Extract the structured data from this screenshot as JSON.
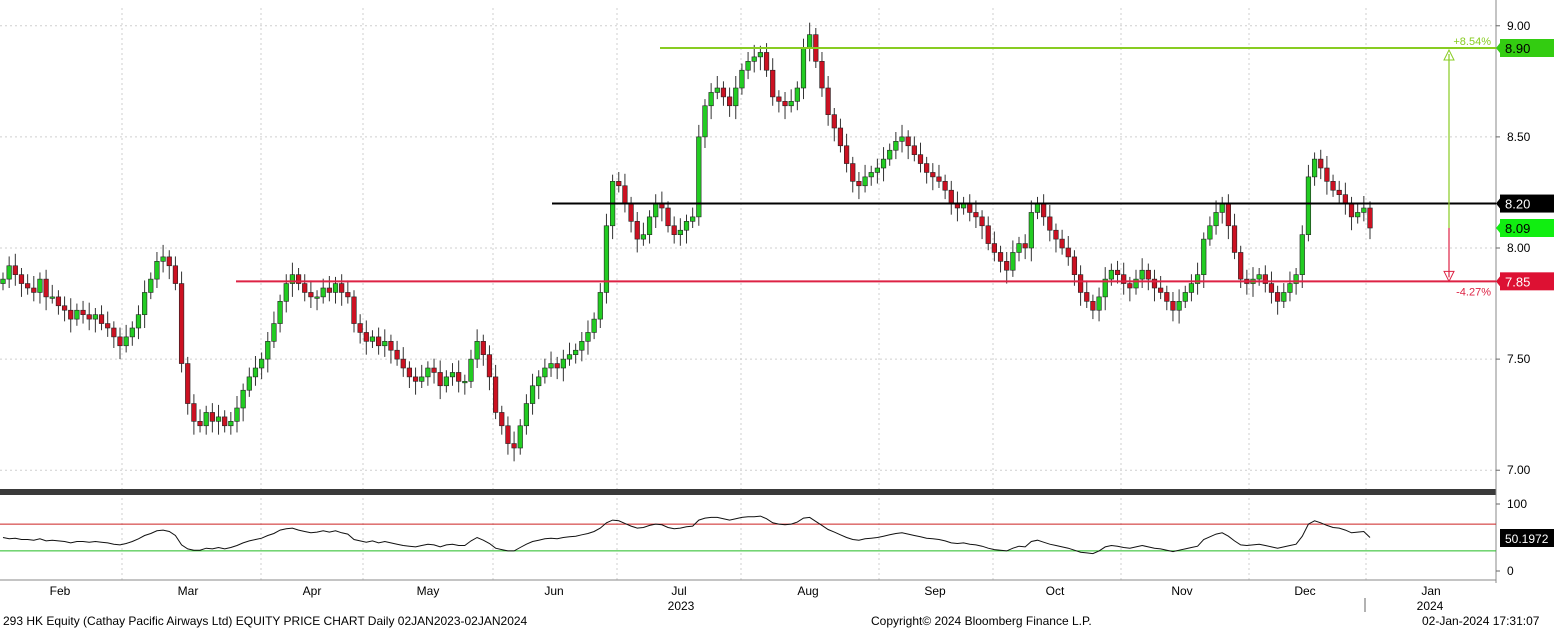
{
  "footer": {
    "description": "293 HK Equity (Cathay Pacific Airways Ltd) EQUITY PRICE CHART  Daily 02JAN2023-02JAN2024",
    "copyright": "Copyright© 2024 Bloomberg Finance L.P.",
    "timestamp": "02-Jan-2024 17:31:07"
  },
  "colors": {
    "up": "#22cc22",
    "down": "#cc1122",
    "resistance": "#88cc22",
    "support": "#dd2244",
    "pivot": "#000000",
    "rsi_over": "#cc2222",
    "rsi_under": "#22bb22"
  },
  "chart_data": [
    {
      "type": "candlestick",
      "ticker": "293 HK Equity",
      "x_month_labels": [
        "Feb",
        "Mar",
        "Apr",
        "May",
        "Jun",
        "Jul",
        "Aug",
        "Sep",
        "Oct",
        "Nov",
        "Dec",
        "Jan"
      ],
      "x_year_labels": [
        "2023",
        "2024"
      ],
      "y_ticks": [
        "9.00",
        "8.50",
        "8.00",
        "7.50",
        "7.00"
      ],
      "ylim": [
        6.92,
        9.08
      ],
      "price_labels": {
        "resistance": "8.90",
        "pivot": "8.20",
        "last": "8.09",
        "support": "7.85"
      },
      "pct_labels": {
        "up": "+8.54%",
        "down": "-4.27%"
      },
      "levels": {
        "resistance": 8.9,
        "pivot": 8.2,
        "support": 7.85
      },
      "series_close": [
        7.86,
        7.92,
        7.88,
        7.84,
        7.82,
        7.8,
        7.86,
        7.78,
        7.78,
        7.74,
        7.72,
        7.68,
        7.72,
        7.7,
        7.68,
        7.7,
        7.66,
        7.64,
        7.6,
        7.56,
        7.6,
        7.64,
        7.7,
        7.8,
        7.86,
        7.94,
        7.96,
        7.92,
        7.84,
        7.48,
        7.3,
        7.22,
        7.2,
        7.26,
        7.22,
        7.24,
        7.2,
        7.22,
        7.28,
        7.36,
        7.42,
        7.46,
        7.5,
        7.58,
        7.66,
        7.76,
        7.84,
        7.88,
        7.84,
        7.8,
        7.78,
        7.78,
        7.82,
        7.8,
        7.84,
        7.8,
        7.78,
        7.66,
        7.62,
        7.58,
        7.6,
        7.56,
        7.58,
        7.54,
        7.5,
        7.46,
        7.42,
        7.4,
        7.42,
        7.46,
        7.44,
        7.38,
        7.42,
        7.44,
        7.4,
        7.4,
        7.5,
        7.58,
        7.52,
        7.42,
        7.26,
        7.2,
        7.12,
        7.1,
        7.2,
        7.3,
        7.38,
        7.42,
        7.46,
        7.48,
        7.46,
        7.5,
        7.52,
        7.54,
        7.58,
        7.62,
        7.68,
        7.8,
        8.1,
        8.3,
        8.28,
        8.2,
        8.12,
        8.04,
        8.06,
        8.14,
        8.2,
        8.18,
        8.1,
        8.06,
        8.08,
        8.12,
        8.14,
        8.5,
        8.64,
        8.7,
        8.72,
        8.68,
        8.64,
        8.72,
        8.8,
        8.84,
        8.86,
        8.88,
        8.8,
        8.68,
        8.66,
        8.64,
        8.66,
        8.72,
        8.9,
        8.96,
        8.84,
        8.72,
        8.6,
        8.54,
        8.46,
        8.38,
        8.3,
        8.28,
        8.32,
        8.34,
        8.36,
        8.4,
        8.44,
        8.48,
        8.5,
        8.46,
        8.42,
        8.38,
        8.34,
        8.32,
        8.3,
        8.26,
        8.2,
        8.18,
        8.2,
        8.16,
        8.14,
        8.1,
        8.02,
        7.98,
        7.94,
        7.9,
        7.98,
        8.02,
        8.0,
        8.16,
        8.2,
        8.14,
        8.08,
        8.04,
        8.0,
        7.96,
        7.88,
        7.8,
        7.76,
        7.72,
        7.78,
        7.86,
        7.9,
        7.88,
        7.84,
        7.82,
        7.86,
        7.9,
        7.86,
        7.82,
        7.8,
        7.76,
        7.72,
        7.76,
        7.8,
        7.84,
        7.88,
        8.04,
        8.1,
        8.16,
        8.2,
        8.1,
        7.98,
        7.86,
        7.84,
        7.86,
        7.88,
        7.84,
        7.8,
        7.76,
        7.8,
        7.84,
        7.88,
        8.06,
        8.32,
        8.4,
        8.36,
        8.3,
        8.26,
        8.24,
        8.2,
        8.14,
        8.16,
        8.18,
        8.09
      ],
      "rsi": {
        "ylim": [
          0,
          100
        ],
        "y_ticks": [
          "100",
          "0"
        ],
        "overbought": 70,
        "oversold": 30,
        "last_label": "50.1972",
        "values": [
          50,
          48,
          49,
          47,
          47,
          46,
          48,
          45,
          46,
          45,
          44,
          42,
          44,
          44,
          43,
          44,
          43,
          42,
          40,
          39,
          41,
          44,
          48,
          53,
          56,
          60,
          61,
          59,
          53,
          39,
          33,
          31,
          31,
          34,
          33,
          35,
          33,
          35,
          38,
          42,
          45,
          47,
          49,
          53,
          56,
          61,
          63,
          64,
          61,
          59,
          57,
          58,
          60,
          58,
          60,
          57,
          55,
          47,
          45,
          43,
          45,
          42,
          44,
          42,
          40,
          38,
          37,
          36,
          38,
          40,
          39,
          36,
          39,
          40,
          38,
          38,
          45,
          50,
          46,
          41,
          34,
          32,
          30,
          30,
          35,
          40,
          44,
          46,
          48,
          49,
          48,
          50,
          51,
          52,
          54,
          56,
          59,
          64,
          72,
          76,
          75,
          71,
          67,
          64,
          65,
          68,
          70,
          69,
          65,
          63,
          64,
          66,
          67,
          76,
          79,
          80,
          80,
          78,
          76,
          78,
          80,
          81,
          81,
          82,
          78,
          72,
          70,
          69,
          70,
          73,
          79,
          80,
          74,
          68,
          62,
          58,
          54,
          50,
          47,
          46,
          48,
          49,
          50,
          52,
          54,
          56,
          57,
          55,
          53,
          51,
          49,
          48,
          47,
          45,
          42,
          41,
          42,
          40,
          39,
          37,
          34,
          32,
          31,
          30,
          34,
          37,
          36,
          44,
          46,
          43,
          40,
          38,
          36,
          34,
          31,
          28,
          27,
          26,
          30,
          36,
          38,
          37,
          35,
          34,
          36,
          38,
          36,
          34,
          33,
          31,
          29,
          31,
          33,
          35,
          37,
          47,
          51,
          55,
          57,
          52,
          45,
          39,
          38,
          39,
          40,
          38,
          36,
          34,
          36,
          38,
          40,
          52,
          70,
          75,
          72,
          68,
          65,
          64,
          61,
          57,
          58,
          59,
          50
        ]
      }
    }
  ]
}
